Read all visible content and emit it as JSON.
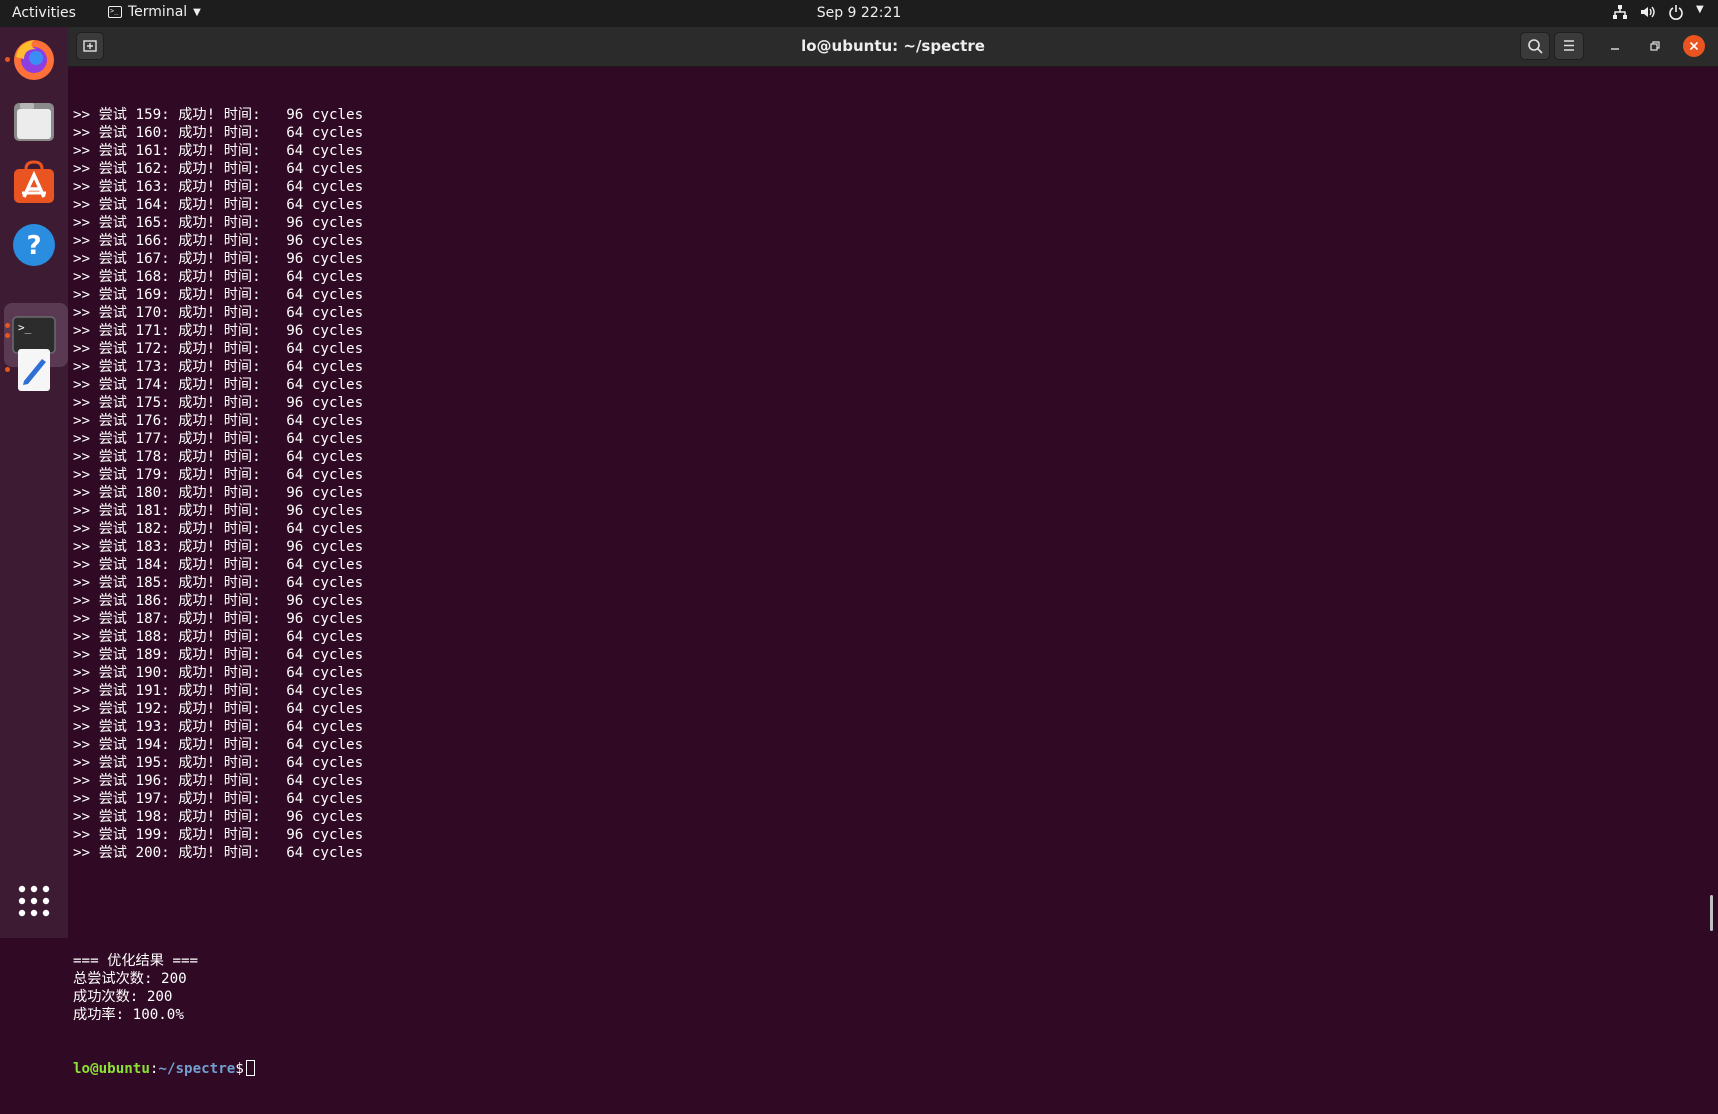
{
  "topbar": {
    "activities": "Activities",
    "app_name": "Terminal",
    "clock": "Sep 9  22:21",
    "icons": [
      "network-icon",
      "volume-icon",
      "power-icon",
      "system-menu-arrow-icon"
    ]
  },
  "dock": {
    "apps": [
      {
        "name": "Firefox",
        "icon": "firefox-icon",
        "running": true
      },
      {
        "name": "Files",
        "icon": "files-icon",
        "running": false
      },
      {
        "name": "Ubuntu Software",
        "icon": "software-icon",
        "running": false
      },
      {
        "name": "Help",
        "icon": "help-icon",
        "running": false
      },
      {
        "name": "Terminal",
        "icon": "terminal-icon",
        "running": true,
        "active": true
      },
      {
        "name": "Text Editor",
        "icon": "text-editor-icon",
        "running": true
      }
    ],
    "show_apps_icon": "grid-icon"
  },
  "window": {
    "title": "lo@ubuntu: ~/spectre",
    "accent_close": "#e95420"
  },
  "terminal": {
    "attempts": [
      ">> 尝试 159: 成功! 时间:   96 cycles",
      ">> 尝试 160: 成功! 时间:   64 cycles",
      ">> 尝试 161: 成功! 时间:   64 cycles",
      ">> 尝试 162: 成功! 时间:   64 cycles",
      ">> 尝试 163: 成功! 时间:   64 cycles",
      ">> 尝试 164: 成功! 时间:   64 cycles",
      ">> 尝试 165: 成功! 时间:   96 cycles",
      ">> 尝试 166: 成功! 时间:   96 cycles",
      ">> 尝试 167: 成功! 时间:   96 cycles",
      ">> 尝试 168: 成功! 时间:   64 cycles",
      ">> 尝试 169: 成功! 时间:   64 cycles",
      ">> 尝试 170: 成功! 时间:   64 cycles",
      ">> 尝试 171: 成功! 时间:   96 cycles",
      ">> 尝试 172: 成功! 时间:   64 cycles",
      ">> 尝试 173: 成功! 时间:   64 cycles",
      ">> 尝试 174: 成功! 时间:   64 cycles",
      ">> 尝试 175: 成功! 时间:   96 cycles",
      ">> 尝试 176: 成功! 时间:   64 cycles",
      ">> 尝试 177: 成功! 时间:   64 cycles",
      ">> 尝试 178: 成功! 时间:   64 cycles",
      ">> 尝试 179: 成功! 时间:   64 cycles",
      ">> 尝试 180: 成功! 时间:   96 cycles",
      ">> 尝试 181: 成功! 时间:   96 cycles",
      ">> 尝试 182: 成功! 时间:   64 cycles",
      ">> 尝试 183: 成功! 时间:   96 cycles",
      ">> 尝试 184: 成功! 时间:   64 cycles",
      ">> 尝试 185: 成功! 时间:   64 cycles",
      ">> 尝试 186: 成功! 时间:   96 cycles",
      ">> 尝试 187: 成功! 时间:   96 cycles",
      ">> 尝试 188: 成功! 时间:   64 cycles",
      ">> 尝试 189: 成功! 时间:   64 cycles",
      ">> 尝试 190: 成功! 时间:   64 cycles",
      ">> 尝试 191: 成功! 时间:   64 cycles",
      ">> 尝试 192: 成功! 时间:   64 cycles",
      ">> 尝试 193: 成功! 时间:   64 cycles",
      ">> 尝试 194: 成功! 时间:   64 cycles",
      ">> 尝试 195: 成功! 时间:   64 cycles",
      ">> 尝试 196: 成功! 时间:   64 cycles",
      ">> 尝试 197: 成功! 时间:   64 cycles",
      ">> 尝试 198: 成功! 时间:   96 cycles",
      ">> 尝试 199: 成功! 时间:   96 cycles",
      ">> 尝试 200: 成功! 时间:   64 cycles"
    ],
    "summary": [
      "=== 优化结果 ===",
      "总尝试次数: 200",
      "成功次数: 200",
      "成功率: 100.0%"
    ],
    "prompt": {
      "user_host": "lo@ubuntu",
      "separator": ":",
      "path": "~/spectre",
      "symbol": "$"
    },
    "colors": {
      "background": "#300a24",
      "text": "#ffffff",
      "prompt_user": "#8ae234",
      "prompt_path": "#729fcf"
    }
  }
}
